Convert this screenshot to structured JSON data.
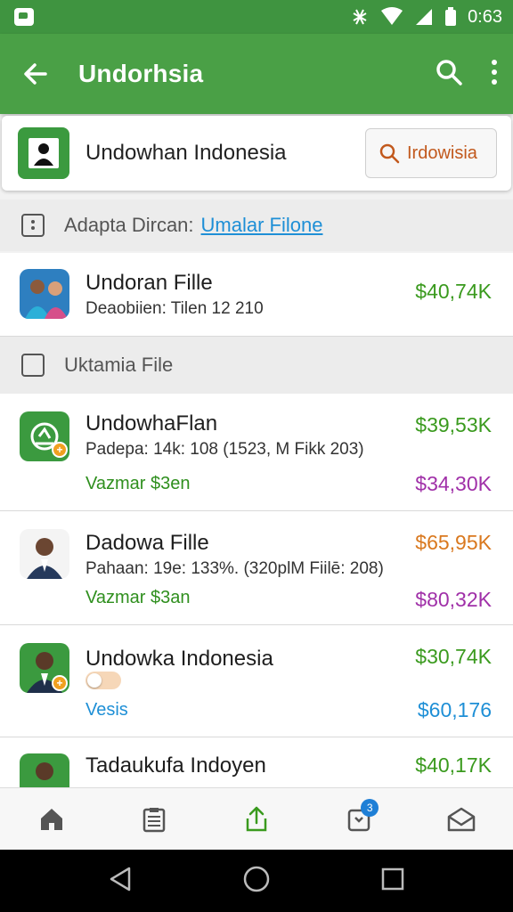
{
  "status_bar": {
    "time": "0:63"
  },
  "app_bar": {
    "title": "Undorhsia"
  },
  "header": {
    "name": "Undowhan Indonesia",
    "search_label": "Irdowisia"
  },
  "section1": {
    "label": "Adapta Dircan:",
    "link": "Umalar Filone"
  },
  "section2": {
    "label": "Uktamia File"
  },
  "rows": [
    {
      "title": "Undoran Fille",
      "subtitle": "Deaobiien: Tilen 12 210",
      "value1": "$40,74K",
      "value1_color": "#3a9a1e"
    },
    {
      "title": "UndowhaFlan",
      "subtitle": "Padepa: 14k: 108  (1523, M Fikk 203)",
      "tag": "Vazmar $3en",
      "value1": "$39,53K",
      "value1_color": "#3a9a1e",
      "value2": "$34,30K",
      "value2_color": "#a030a8"
    },
    {
      "title": "Dadowa Fille",
      "subtitle": "Pahaan: 19e: 133%. (320plM Fiilē: 208)",
      "tag": "Vazmar $3an",
      "value1": "$65,95K",
      "value1_color": "#d9781e",
      "value2": "$80,32K",
      "value2_color": "#a030a8"
    },
    {
      "title": "Undowka Indonesia",
      "tag": "Vesis",
      "value1": "$30,74K",
      "value1_color": "#3a9a1e",
      "value2": "$60,176",
      "value2_color": "#1e8fd6"
    },
    {
      "title": "Tadaukufa Indoyen",
      "value1": "$40,17K",
      "value1_color": "#3a9a1e"
    }
  ],
  "bottom_nav": {
    "badge": "3"
  },
  "colors": {
    "brand": "#4aa046",
    "green_text": "#2f8f1e",
    "link": "#1e8fd6"
  }
}
